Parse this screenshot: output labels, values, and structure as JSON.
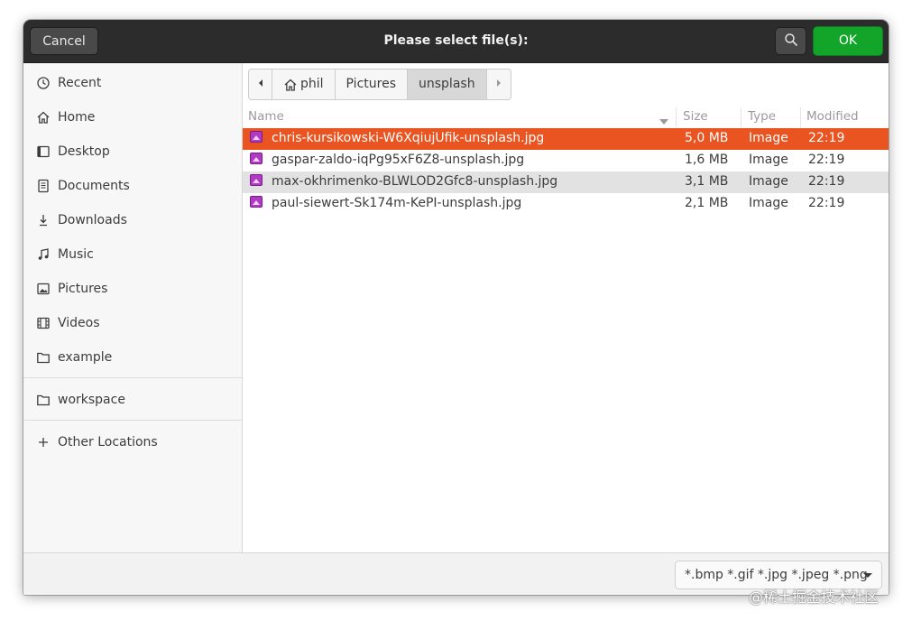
{
  "header": {
    "cancel_label": "Cancel",
    "title": "Please select file(s):",
    "ok_label": "OK"
  },
  "sidebar": {
    "items": [
      {
        "label": "Recent",
        "icon": "clock-icon"
      },
      {
        "label": "Home",
        "icon": "home-icon"
      },
      {
        "label": "Desktop",
        "icon": "desktop-icon"
      },
      {
        "label": "Documents",
        "icon": "document-icon"
      },
      {
        "label": "Downloads",
        "icon": "download-icon"
      },
      {
        "label": "Music",
        "icon": "music-icon"
      },
      {
        "label": "Pictures",
        "icon": "picture-icon"
      },
      {
        "label": "Videos",
        "icon": "video-icon"
      },
      {
        "label": "example",
        "icon": "folder-icon"
      }
    ],
    "bookmarks": [
      {
        "label": "workspace",
        "icon": "folder-icon"
      }
    ],
    "other_locations": {
      "label": "Other Locations",
      "icon": "plus-icon"
    }
  },
  "pathbar": {
    "crumbs": [
      "phil",
      "Pictures",
      "unsplash"
    ],
    "active": "unsplash"
  },
  "columns": {
    "name": "Name",
    "size": "Size",
    "type": "Type",
    "modified": "Modified"
  },
  "files": [
    {
      "name": "chris-kursikowski-W6XqiujUfik-unsplash.jpg",
      "size": "5,0 MB",
      "type": "Image",
      "modified": "22:19",
      "state": "selected"
    },
    {
      "name": "gaspar-zaldo-iqPg95xF6Z8-unsplash.jpg",
      "size": "1,6 MB",
      "type": "Image",
      "modified": "22:19",
      "state": "normal"
    },
    {
      "name": "max-okhrimenko-BLWLOD2Gfc8-unsplash.jpg",
      "size": "3,1 MB",
      "type": "Image",
      "modified": "22:19",
      "state": "hover"
    },
    {
      "name": "paul-siewert-Sk174m-KePI-unsplash.jpg",
      "size": "2,1 MB",
      "type": "Image",
      "modified": "22:19",
      "state": "normal"
    }
  ],
  "footer": {
    "filter_label": "*.bmp *.gif *.jpg *.jpeg *.png"
  },
  "watermark": "@稀土掘金技术社区",
  "colors": {
    "header_bg": "#2c2c2c",
    "ok_green": "#12a529",
    "selection_orange": "#e95420",
    "hover_gray": "#e2e2e2",
    "image_icon_purple": "#b03ac4"
  }
}
